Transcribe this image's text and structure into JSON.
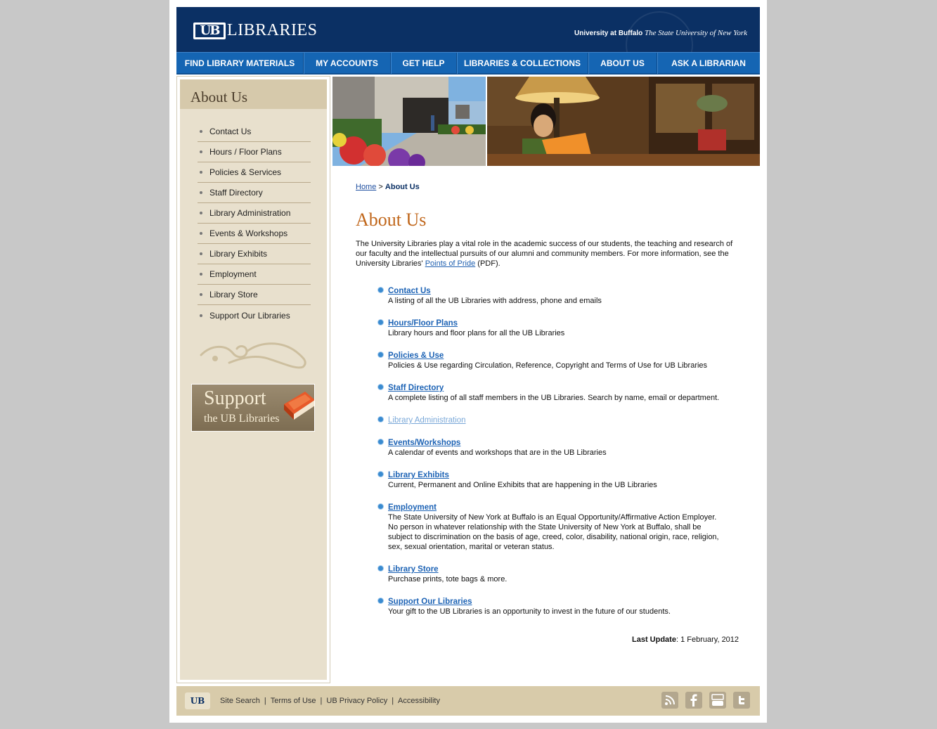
{
  "header": {
    "logo_mark": "UB",
    "logo_text": "LIBRARIES",
    "univ_bold": "University at Buffalo",
    "univ_italic": "The State University of New York"
  },
  "nav": [
    {
      "label": "FIND LIBRARY MATERIALS"
    },
    {
      "label": "MY ACCOUNTS"
    },
    {
      "label": "GET HELP"
    },
    {
      "label": "LIBRARIES & COLLECTIONS"
    },
    {
      "label": "ABOUT US"
    },
    {
      "label": "ASK A LIBRARIAN"
    }
  ],
  "sidebar": {
    "title": "About Us",
    "items": [
      {
        "label": "Contact Us"
      },
      {
        "label": "Hours / Floor Plans"
      },
      {
        "label": "Policies & Services"
      },
      {
        "label": "Staff Directory"
      },
      {
        "label": "Library Administration"
      },
      {
        "label": "Events & Workshops"
      },
      {
        "label": "Library Exhibits"
      },
      {
        "label": "Employment"
      },
      {
        "label": "Library Store"
      },
      {
        "label": "Support Our Libraries"
      }
    ],
    "support_banner": {
      "line1": "Support",
      "line2": "the UB Libraries"
    }
  },
  "breadcrumb": {
    "home": "Home",
    "separator": ">",
    "current": "About Us"
  },
  "main": {
    "heading": "About Us",
    "intro_text": "The University Libraries play a vital role in the academic success of our students, the teaching and research of our faculty and the intellectual pursuits of our alumni and community members. For more information, see the University Libraries' ",
    "intro_link": "Points of Pride",
    "intro_suffix": " (PDF).",
    "links": [
      {
        "title": "Contact Us",
        "desc": "A listing of all the UB Libraries with address, phone and emails"
      },
      {
        "title": "Hours/Floor Plans",
        "desc": "Library hours and floor plans for all the UB Libraries"
      },
      {
        "title": "Policies & Use",
        "desc": "Policies & Use regarding Circulation, Reference, Copyright and Terms of Use for UB Libraries"
      },
      {
        "title": "Staff Directory",
        "desc": "A complete listing of all staff members in the UB Libraries. Search by name, email or department."
      },
      {
        "title": "Library Administration",
        "desc": ""
      },
      {
        "title": "Events/Workshops",
        "desc": "A calendar of events and workshops that are in the UB Libraries"
      },
      {
        "title": "Library Exhibits",
        "desc": "Current, Permanent and Online Exhibits that are happening in the UB Libraries"
      },
      {
        "title": "Employment",
        "desc": "The State University of New York at Buffalo is an Equal Opportunity/Affirmative Action Employer. No person in whatever relationship with the State University of New York at Buffalo, shall be subject to discrimination on the basis of age, creed, color, disability, national origin, race, religion, sex, sexual orientation, marital or veteran status."
      },
      {
        "title": "Library Store",
        "desc": "Purchase prints, tote bags & more."
      },
      {
        "title": "Support Our Libraries",
        "desc": "Your gift to the UB Libraries is an opportunity to invest in the future of our students."
      }
    ],
    "last_update_label": "Last Update",
    "last_update_value": ": 1 February, 2012"
  },
  "footer": {
    "logo": "UB",
    "links": [
      "Site Search",
      "Terms of Use",
      "UB Privacy Policy",
      "Accessibility"
    ],
    "separator": "|",
    "social": [
      "rss-icon",
      "facebook-icon",
      "youtube-icon",
      "twitter-icon"
    ]
  },
  "colors": {
    "header_bg": "#0b3064",
    "nav_bg": "#1565b3",
    "sidebar_bg": "#e8e0cd",
    "heading": "#c0661a",
    "link": "#1d63b5",
    "footer_bg": "#d8cbaa"
  }
}
